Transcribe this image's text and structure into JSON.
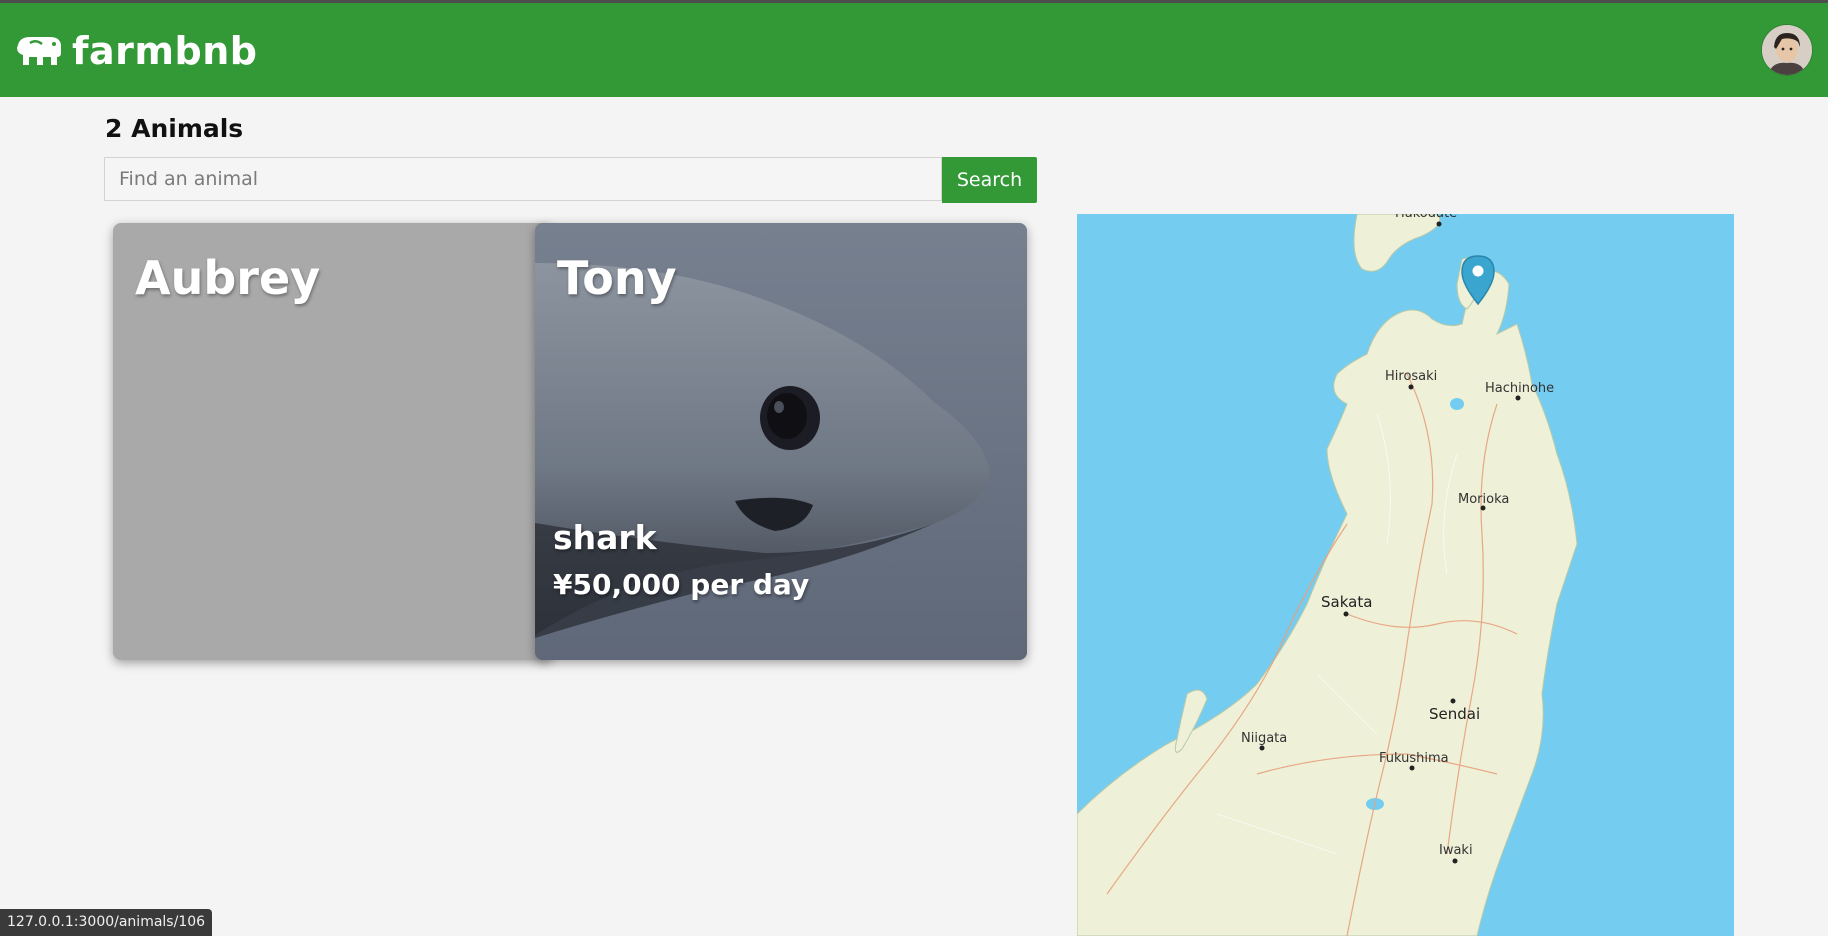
{
  "app": {
    "brand": "farmbnb",
    "brand_color": "#339937"
  },
  "header": {
    "logo_icon": "cow-icon",
    "avatar_icon": "user-avatar"
  },
  "results": {
    "count_label": "2 Animals"
  },
  "search": {
    "placeholder": "Find an animal",
    "value": "",
    "button_label": "Search"
  },
  "cards": [
    {
      "name": "Aubrey",
      "species": "",
      "price": ""
    },
    {
      "name": "Tony",
      "species": "shark",
      "price": "¥50,000 per day"
    }
  ],
  "map": {
    "water_color": "#74cdf0",
    "land_color": "#eef0d8",
    "pin_icon": "map-pin-icon",
    "cities": [
      "Hakodate",
      "Hirosaki",
      "Hachinohe",
      "Morioka",
      "Sakata",
      "Sendai",
      "Niigata",
      "Fukushima",
      "Iwaki"
    ]
  },
  "status_bar": {
    "url": "127.0.0.1:3000/animals/106"
  }
}
